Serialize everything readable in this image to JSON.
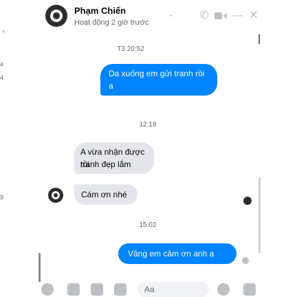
{
  "header": {
    "name": "Phạm Chiến",
    "status": "Hoạt động 2 giờ trước",
    "icons": [
      "phone-icon",
      "video-icon",
      "minimize-icon",
      "close-icon"
    ]
  },
  "edge": {
    "left_a": "a",
    "left_4": "4",
    "left_9": "9"
  },
  "messages": [
    {
      "type": "timestamp",
      "text": "T3 20:52"
    },
    {
      "type": "outgoing",
      "lines": [
        "Da xuống em gửi tranh rồi",
        "a"
      ]
    },
    {
      "type": "timestamp",
      "text": "12:18"
    },
    {
      "type": "incoming",
      "lines": [
        "A vừa nhận được rồi",
        "tranh đẹp lắm"
      ]
    },
    {
      "type": "incoming",
      "lines": [
        "Cám ơn nhé"
      ]
    },
    {
      "type": "timestamp",
      "text": "15:02"
    },
    {
      "type": "outgoing",
      "lines": [
        "Vâng em cảm ơn anh ạ"
      ]
    }
  ],
  "composer": {
    "placeholder": "Aa",
    "icons": [
      "plus-icon",
      "image-icon",
      "sticker-icon",
      "gif-icon",
      "emoji-icon",
      "like-icon"
    ]
  },
  "colors": {
    "accent": "#0084ff",
    "incoming_bubble": "#e4e6eb",
    "muted": "#65676b"
  }
}
